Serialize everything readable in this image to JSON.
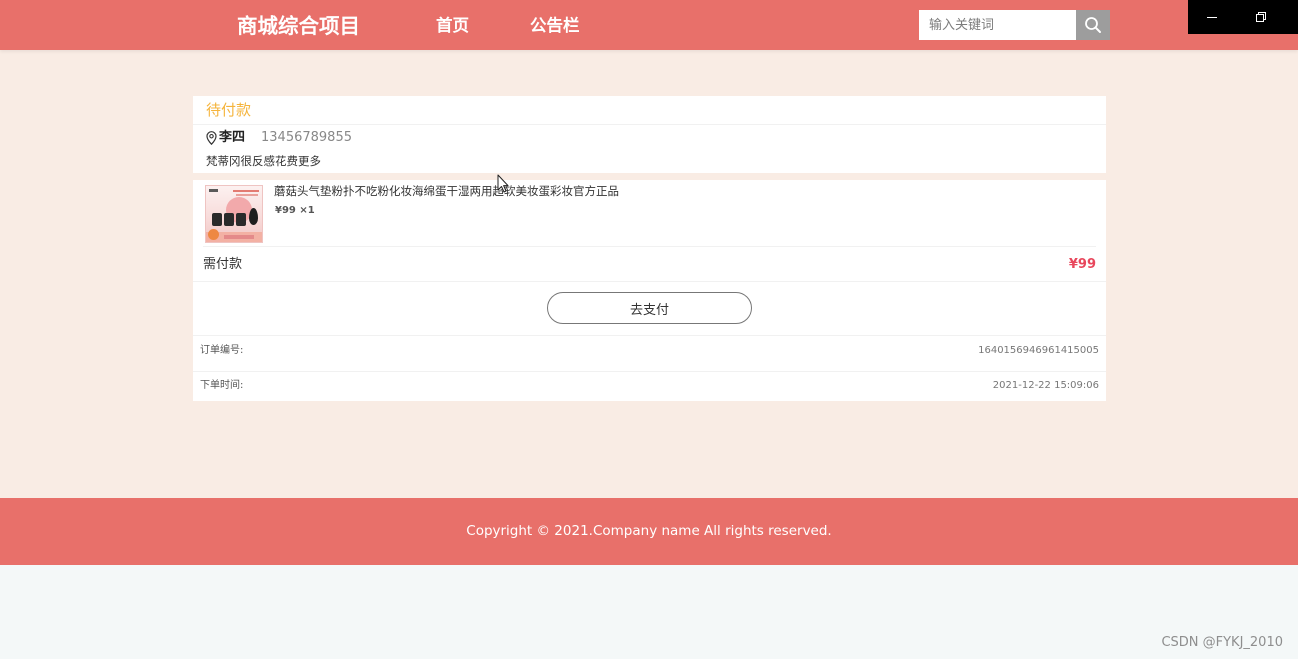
{
  "window_controls": {
    "minimize_icon": "minimize-icon",
    "restore_icon": "restore-icon"
  },
  "header": {
    "brand": "商城综合项目",
    "nav": [
      {
        "label": "首页"
      },
      {
        "label": "公告栏"
      }
    ],
    "search": {
      "placeholder": "输入关键词",
      "icon": "search-icon"
    }
  },
  "order": {
    "status": "待付款",
    "address": {
      "icon": "location-pin-icon",
      "name": "李四",
      "phone": "13456789855",
      "detail": "梵蒂冈很反感花费更多"
    },
    "items": [
      {
        "title": "蘑菇头气垫粉扑不吃粉化妆海绵蛋干湿两用超软美妆蛋彩妆官方正品",
        "price": "¥99",
        "quantity": "×1"
      }
    ],
    "payable": {
      "label": "需付款",
      "amount": "¥99"
    },
    "pay_button": "去支付",
    "order_number": {
      "label": "订单编号:",
      "value": "1640156946961415005"
    },
    "order_time": {
      "label": "下单时间:",
      "value": "2021-12-22 15:09:06"
    }
  },
  "footer": {
    "copyright": "Copyright © 2021.Company name All rights reserved."
  },
  "watermark": "CSDN @FYKJ_2010",
  "colors": {
    "accent": "#E8706A",
    "status": "#F5B43C",
    "price": "#E8475C",
    "page_background": "#F9ECE4",
    "bottom_background": "#F4F8F8"
  }
}
